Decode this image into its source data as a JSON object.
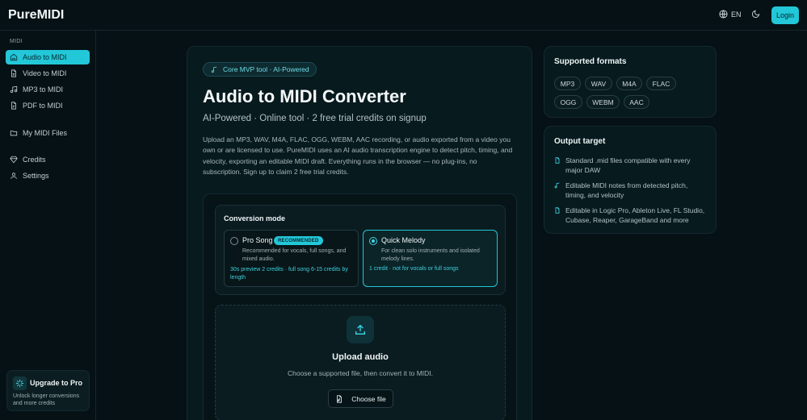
{
  "header": {
    "brand": "PureMIDI",
    "lang": "EN",
    "login_label": "Login"
  },
  "sidebar": {
    "section_label": "MIDI",
    "items": [
      {
        "label": "Audio to MIDI",
        "icon": "audio-file-icon",
        "active": true
      },
      {
        "label": "Video to MIDI",
        "icon": "video-file-icon"
      },
      {
        "label": "MP3 to MIDI",
        "icon": "music-note-icon"
      },
      {
        "label": "PDF to MIDI",
        "icon": "pdf-file-icon"
      },
      {
        "label": "My MIDI Files",
        "icon": "folder-icon"
      },
      {
        "label": "Credits",
        "icon": "gem-icon"
      },
      {
        "label": "Settings",
        "icon": "user-icon"
      }
    ],
    "upgrade": {
      "title": "Upgrade to Pro",
      "desc": "Unlock longer conversions and more credits"
    }
  },
  "main": {
    "tag": "Core MVP tool · AI-Powered",
    "title": "Audio to MIDI Converter",
    "subtitle": "AI-Powered · Online tool · 2 free trial credits on signup",
    "description": "Upload an MP3, WAV, M4A, FLAC, OGG, WEBM, AAC recording, or audio exported from a video you own or are licensed to use. PureMIDI uses an AI audio transcription engine to detect pitch, timing, and velocity, exporting an editable MIDI draft. Everything runs in the browser — no plug-ins, no subscription. Sign up to claim 2 free trial credits.",
    "mode": {
      "title": "Conversion mode",
      "options": [
        {
          "name": "Pro Song",
          "badge": "RECOMMENDED",
          "desc": "Recommended for vocals, full songs, and mixed audio.",
          "note": "30s preview 2 credits · full song 6-15 credits by length",
          "selected": false
        },
        {
          "name": "Quick Melody",
          "desc": "For clean solo instruments and isolated melody lines.",
          "note": "1 credit · not for vocals or full songs",
          "selected": true
        }
      ]
    },
    "upload": {
      "title": "Upload audio",
      "desc": "Choose a supported file, then convert it to MIDI.",
      "button": "Choose file"
    }
  },
  "formats": {
    "title": "Supported formats",
    "items": [
      "MP3",
      "WAV",
      "M4A",
      "FLAC",
      "OGG",
      "WEBM",
      "AAC"
    ]
  },
  "output": {
    "title": "Output target",
    "items": [
      "Standard .mid files compatible with every major DAW",
      "Editable MIDI notes from detected pitch, timing, and velocity",
      "Editable in Logic Pro, Ableton Live, FL Studio, Cubase, Reaper, GarageBand and more"
    ]
  },
  "colors": {
    "accent": "#22c7d8",
    "background": "#051115",
    "card": "#071a1e"
  }
}
